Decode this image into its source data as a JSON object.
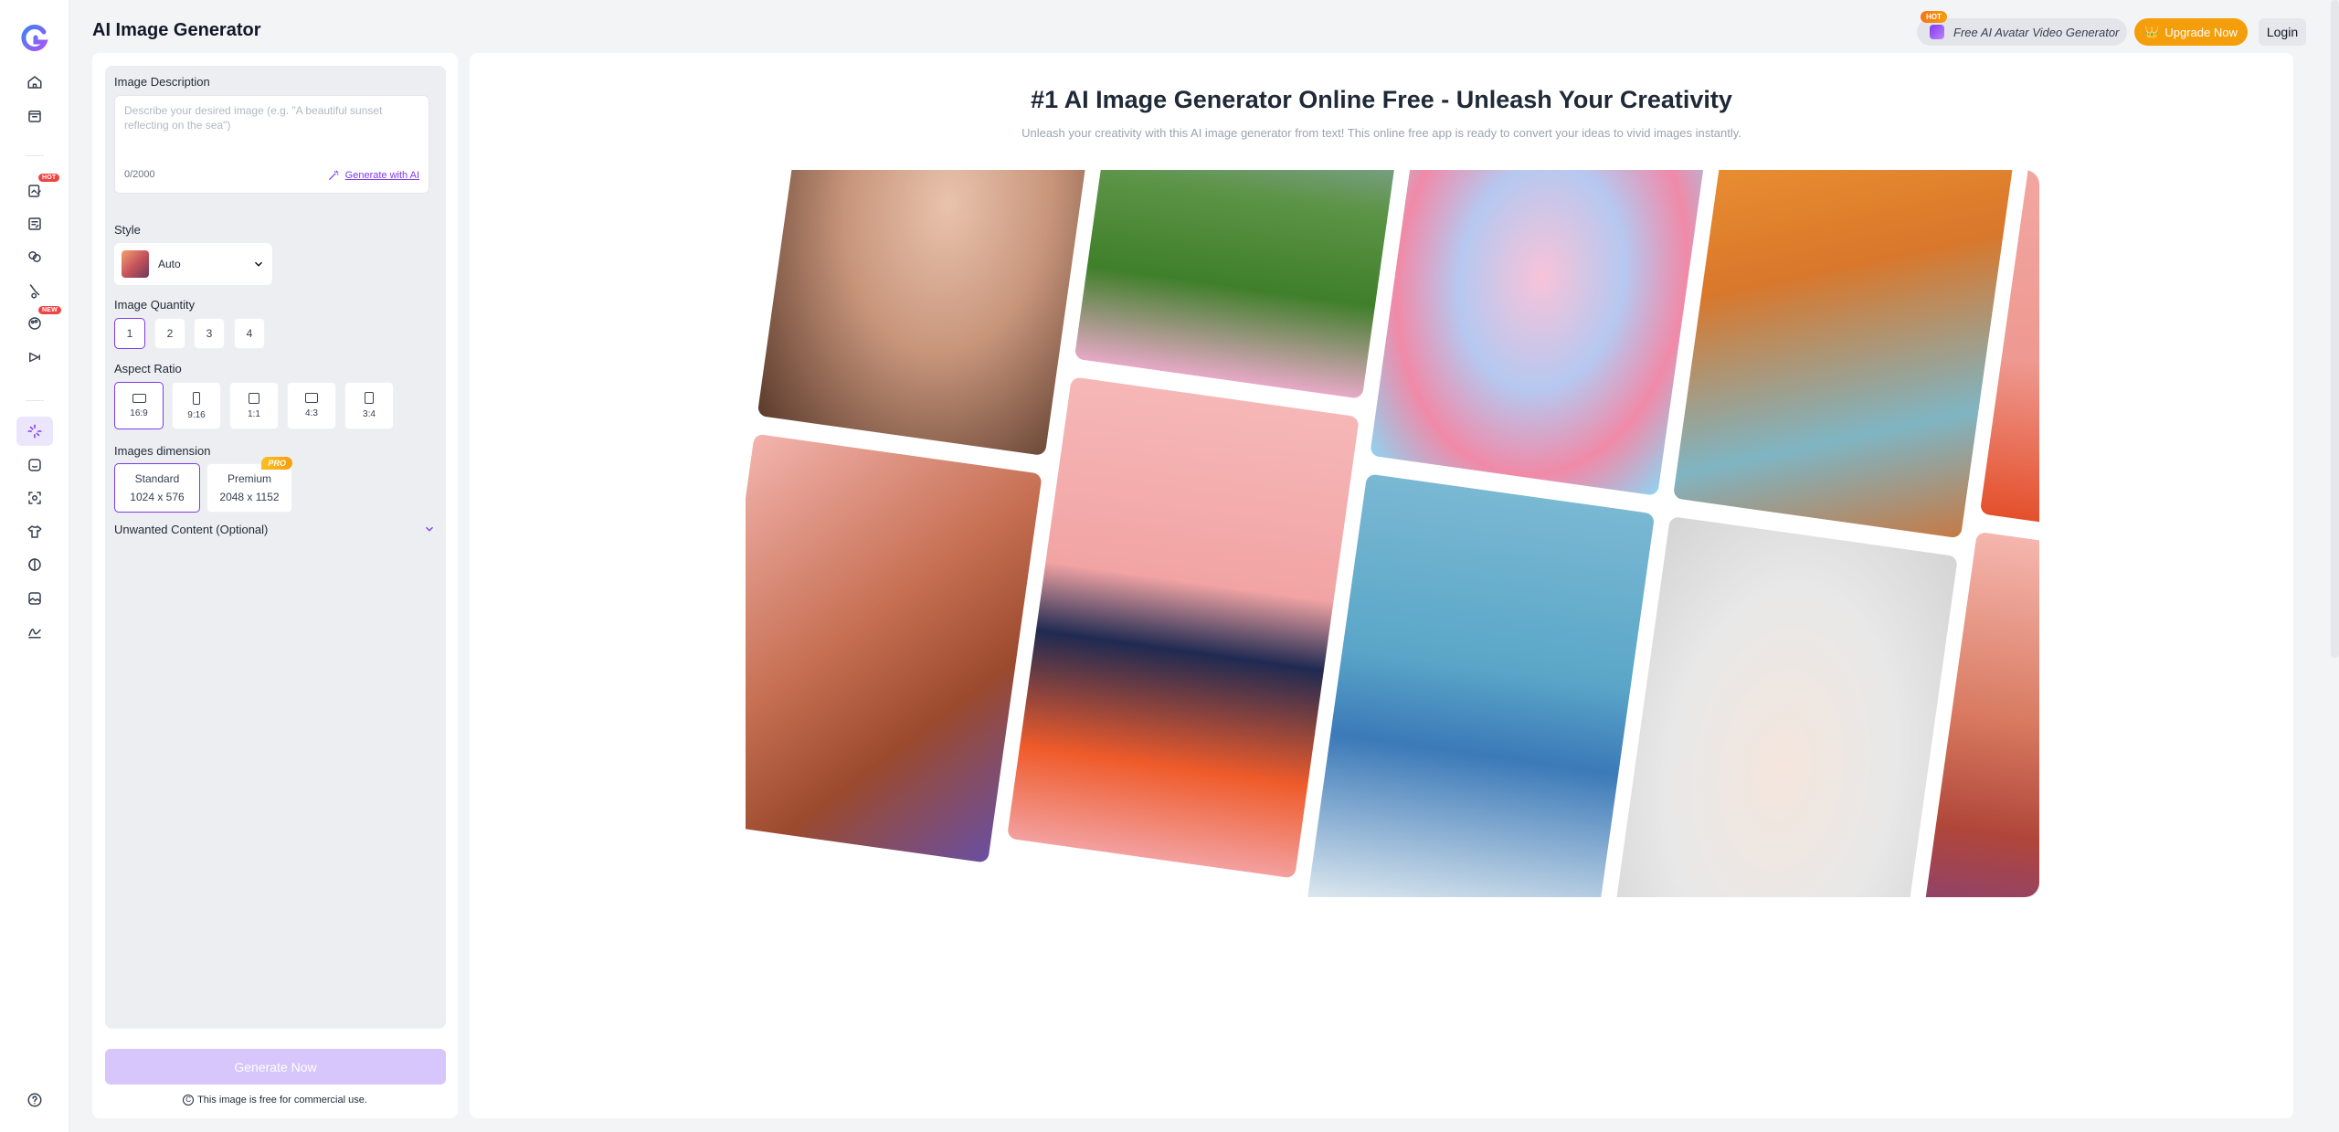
{
  "app": {
    "title": "AI Image Generator"
  },
  "header": {
    "avatar_promo": {
      "label": "Free AI Avatar Video Generator",
      "badge": "HOT"
    },
    "upgrade_label": "Upgrade Now",
    "login_label": "Login"
  },
  "rail": {
    "badges": {
      "hot": "HOT",
      "new": "NEW"
    },
    "icons": [
      "home-icon",
      "store-icon",
      "image-edit-icon",
      "photo-editor-icon",
      "face-swap-icon",
      "object-remove-icon",
      "restyle-icon",
      "video-icon",
      "ai-image-generator-icon",
      "sticker-icon",
      "face-scan-icon",
      "clothes-icon",
      "colorize-icon",
      "photo-frame-icon",
      "signature-icon",
      "help-icon"
    ]
  },
  "panel": {
    "description": {
      "label": "Image Description",
      "placeholder": "Describe your desired image (e.g. \"A beautiful sunset reflecting on the sea\")",
      "count": "0/2000",
      "generate_ai": "Generate with AI"
    },
    "style": {
      "label": "Style",
      "value": "Auto"
    },
    "quantity": {
      "label": "Image Quantity",
      "options": [
        "1",
        "2",
        "3",
        "4"
      ],
      "selected": "1"
    },
    "aspect": {
      "label": "Aspect Ratio",
      "options": [
        "16:9",
        "9:16",
        "1:1",
        "4:3",
        "3:4"
      ],
      "selected": "16:9"
    },
    "dimension": {
      "label": "Images dimension",
      "options": [
        {
          "name": "Standard",
          "size": "1024 x 576"
        },
        {
          "name": "Premium",
          "size": "2048 x 1152",
          "badge": "PRO"
        }
      ],
      "selected": "Standard"
    },
    "unwanted": "Unwanted Content (Optional)",
    "generate_label": "Generate Now",
    "free_note": "This image is free for commercial use."
  },
  "main": {
    "title": "#1 AI Image Generator Online Free - Unleash Your Creativity",
    "subtitle": "Unleash your creativity with this AI image generator from text! This online free app is ready to convert your ideas to vivid images instantly."
  },
  "colors": {
    "accent": "#7c3aed",
    "upgrade": "#f59e0b",
    "generate_disabled": "#d6c6fb"
  }
}
